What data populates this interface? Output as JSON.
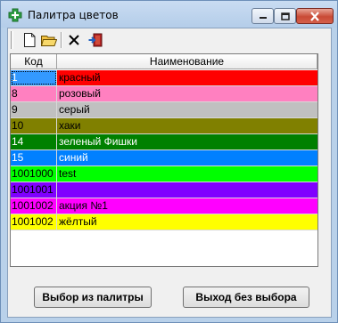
{
  "window": {
    "title": "Палитра цветов"
  },
  "title_buttons": {
    "minimize": "minimize",
    "maximize": "maximize",
    "close": "close"
  },
  "toolbar": {
    "icons": [
      "new-document-icon",
      "open-folder-icon",
      "delete-icon",
      "exit-icon"
    ]
  },
  "grid": {
    "headers": {
      "code": "Код",
      "name": "Наименование"
    },
    "rows": [
      {
        "code": "1",
        "name": "красный",
        "bg": "#ff0000",
        "code_bg": "#3399ff",
        "fg": "#000000",
        "code_fg": "#ffffff",
        "selected": true
      },
      {
        "code": "8",
        "name": "розовый",
        "bg": "#ff80c0",
        "code_bg": "#ff80c0",
        "fg": "#000000",
        "code_fg": "#000000"
      },
      {
        "code": "9",
        "name": "серый",
        "bg": "#c0c0c0",
        "code_bg": "#c0c0c0",
        "fg": "#000000",
        "code_fg": "#000000"
      },
      {
        "code": "10",
        "name": "хаки",
        "bg": "#808000",
        "code_bg": "#808000",
        "fg": "#000000",
        "code_fg": "#000000"
      },
      {
        "code": "14",
        "name": "зеленый Фишки",
        "bg": "#008000",
        "code_bg": "#008000",
        "fg": "#ffffff",
        "code_fg": "#ffffff"
      },
      {
        "code": "15",
        "name": "синий",
        "bg": "#0080ff",
        "code_bg": "#0080ff",
        "fg": "#ffffff",
        "code_fg": "#ffffff"
      },
      {
        "code": "1001000",
        "name": "test",
        "bg": "#00ff00",
        "code_bg": "#00ff00",
        "fg": "#000000",
        "code_fg": "#000000"
      },
      {
        "code": "1001001",
        "name": "",
        "bg": "#8000ff",
        "code_bg": "#8000ff",
        "fg": "#000000",
        "code_fg": "#000000"
      },
      {
        "code": "1001002",
        "name": "акция №1",
        "bg": "#ff00ff",
        "code_bg": "#ff00ff",
        "fg": "#000000",
        "code_fg": "#000000"
      },
      {
        "code": "1001002",
        "name": "жёлтый",
        "bg": "#ffff00",
        "code_bg": "#ffff00",
        "fg": "#000000",
        "code_fg": "#000000"
      }
    ]
  },
  "buttons": {
    "pick_label": "Выбор из палитры",
    "exit_label": "Выход без выбора"
  }
}
